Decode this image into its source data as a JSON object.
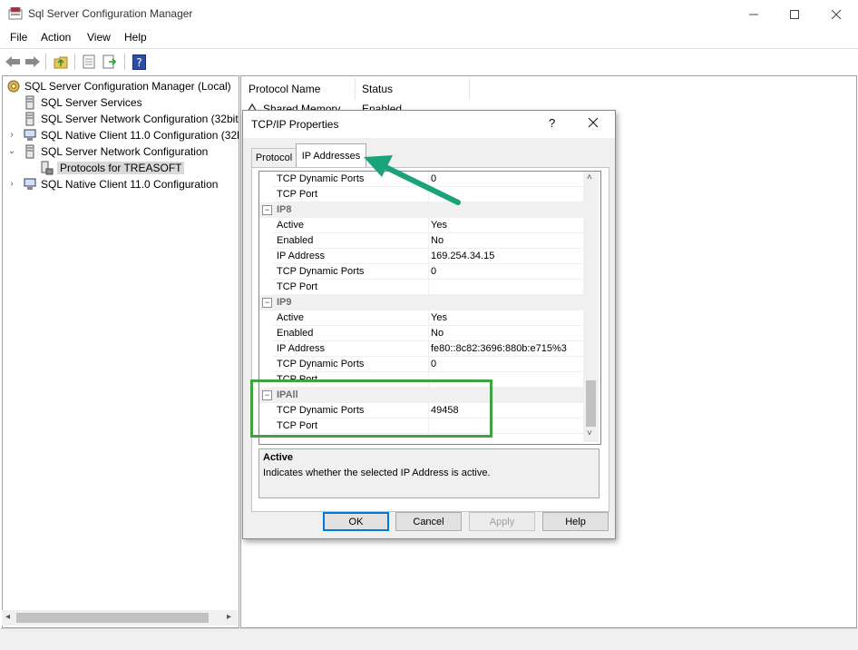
{
  "window": {
    "title": "Sql Server Configuration Manager",
    "menu": [
      "File",
      "Action",
      "View",
      "Help"
    ]
  },
  "tree": {
    "root": "SQL Server Configuration Manager (Local)",
    "items": [
      {
        "label": "SQL Server Services"
      },
      {
        "label": "SQL Server Network Configuration (32bit"
      },
      {
        "label": "SQL Native Client 11.0 Configuration (32b"
      },
      {
        "label": "SQL Server Network Configuration"
      },
      {
        "label": "Protocols for TREASOFT"
      },
      {
        "label": "SQL Native Client 11.0 Configuration"
      }
    ]
  },
  "list": {
    "columns": [
      "Protocol Name",
      "Status"
    ],
    "rows": [
      {
        "name": "Shared Memory",
        "status": "Enabled"
      }
    ]
  },
  "dialog": {
    "title": "TCP/IP Properties",
    "help_glyph": "?",
    "tabs": [
      "Protocol",
      "IP Addresses"
    ],
    "active_tab": "IP Addresses",
    "grid": [
      {
        "type": "prop",
        "name": "TCP Dynamic Ports",
        "value": "0"
      },
      {
        "type": "prop",
        "name": "TCP Port",
        "value": ""
      },
      {
        "type": "group",
        "name": "IP8"
      },
      {
        "type": "prop",
        "name": "Active",
        "value": "Yes"
      },
      {
        "type": "prop",
        "name": "Enabled",
        "value": "No"
      },
      {
        "type": "prop",
        "name": "IP Address",
        "value": "169.254.34.15"
      },
      {
        "type": "prop",
        "name": "TCP Dynamic Ports",
        "value": "0"
      },
      {
        "type": "prop",
        "name": "TCP Port",
        "value": ""
      },
      {
        "type": "group",
        "name": "IP9"
      },
      {
        "type": "prop",
        "name": "Active",
        "value": "Yes"
      },
      {
        "type": "prop",
        "name": "Enabled",
        "value": "No"
      },
      {
        "type": "prop",
        "name": "IP Address",
        "value": "fe80::8c82:3696:880b:e715%3"
      },
      {
        "type": "prop",
        "name": "TCP Dynamic Ports",
        "value": "0"
      },
      {
        "type": "prop",
        "name": "TCP Port",
        "value": ""
      },
      {
        "type": "group",
        "name": "IPAll"
      },
      {
        "type": "prop",
        "name": "TCP Dynamic Ports",
        "value": "49458"
      },
      {
        "type": "prop",
        "name": "TCP Port",
        "value": ""
      }
    ],
    "description": {
      "title": "Active",
      "text": "Indicates whether the selected IP Address is active."
    },
    "buttons": {
      "ok": "OK",
      "cancel": "Cancel",
      "apply": "Apply",
      "help": "Help"
    }
  },
  "colors": {
    "highlight_box": "#3fa33f",
    "arrow": "#1aa37a",
    "default_button_border": "#0078d7"
  }
}
